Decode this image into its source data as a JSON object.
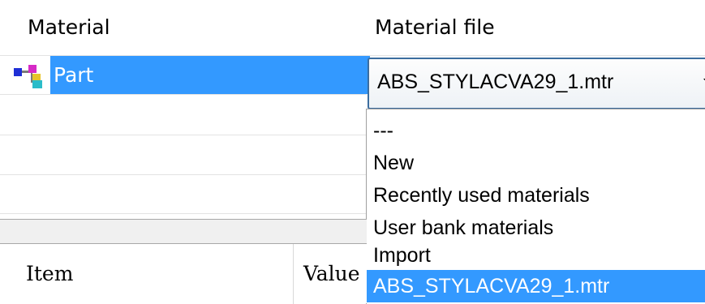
{
  "material_table": {
    "columns": [
      "Material",
      "Material file"
    ],
    "rows": [
      {
        "name": "Part",
        "file": "ABS_STYLACVA29_1.mtr"
      }
    ]
  },
  "combo": {
    "selected": "ABS_STYLACVA29_1.mtr",
    "options": [
      "---",
      "New",
      "Recently used materials",
      "User bank materials",
      "Import",
      "ABS_STYLACVA29_1.mtr"
    ],
    "highlighted_index": 5
  },
  "properties_table": {
    "columns": [
      "Item",
      "Value"
    ]
  },
  "colors": {
    "selection": "#3399ff",
    "combo_border": "#3c6d9f"
  }
}
